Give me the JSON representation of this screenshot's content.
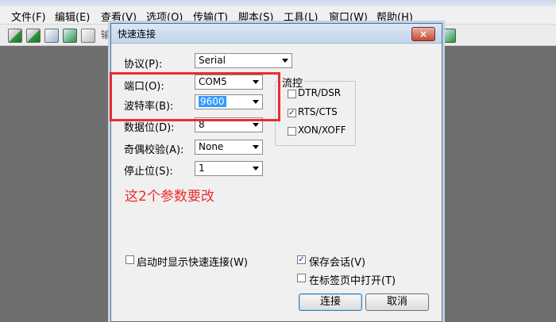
{
  "menu": {
    "items": [
      "文件(F)",
      "编辑(E)",
      "查看(V)",
      "选项(O)",
      "传输(T)",
      "脚本(S)",
      "工具(L)",
      "窗口(W)",
      "帮助(H)"
    ]
  },
  "toolbar": {
    "partial_text": "输"
  },
  "dialog": {
    "title": "快速连接",
    "close_label": "×",
    "protocol_label": "协议(P):",
    "protocol_value": "Serial",
    "port_label": "端口(O):",
    "port_value": "COM5",
    "baud_label": "波特率(B):",
    "baud_value": "9600",
    "databits_label": "数据位(D):",
    "databits_value": "8",
    "parity_label": "奇偶校验(A):",
    "parity_value": "None",
    "stopbits_label": "停止位(S):",
    "stopbits_value": "1",
    "flow_title": "流控",
    "flow_options": [
      {
        "label": "DTR/DSR",
        "checked": false
      },
      {
        "label": "RTS/CTS",
        "checked": true
      },
      {
        "label": "XON/XOFF",
        "checked": false
      }
    ],
    "startup_label": "启动时显示快速连接(W)",
    "startup_checked": false,
    "save_session_label": "保存会话(V)",
    "save_session_checked": true,
    "open_in_tab_label": "在标签页中打开(T)",
    "open_in_tab_checked": false,
    "connect_label": "连接",
    "cancel_label": "取消"
  },
  "annotation": {
    "text": "这2个参数要改",
    "color": "#ec2b2b"
  }
}
